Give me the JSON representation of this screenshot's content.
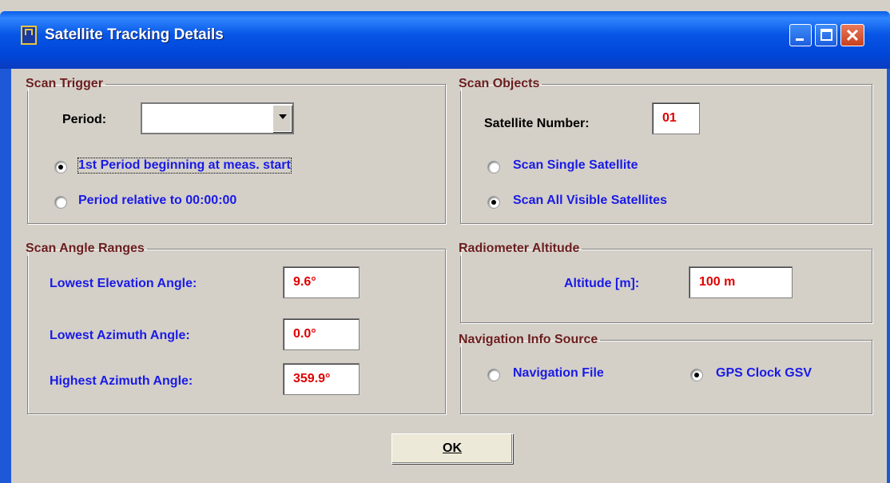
{
  "window": {
    "title": "Satellite Tracking Details"
  },
  "scan_trigger": {
    "legend": "Scan Trigger",
    "period_label": "Period:",
    "period_value": "",
    "radio1_label": "1st Period beginning at meas. start",
    "radio2_label": "Period relative to 00:00:00",
    "selected": "radio1"
  },
  "scan_objects": {
    "legend": "Scan Objects",
    "sat_number_label": "Satellite Number:",
    "sat_number_value": "01",
    "radio1_label": "Scan Single Satellite",
    "radio2_label": "Scan All Visible Satellites",
    "selected": "radio2"
  },
  "scan_angle": {
    "legend": "Scan Angle Ranges",
    "lowest_elevation_label": "Lowest Elevation Angle:",
    "lowest_elevation_value": "9.6°",
    "lowest_azimuth_label": "Lowest Azimuth Angle:",
    "lowest_azimuth_value": "0.0°",
    "highest_azimuth_label": "Highest Azimuth Angle:",
    "highest_azimuth_value": "359.9°"
  },
  "radiometer": {
    "legend": "Radiometer Altitude",
    "altitude_label": "Altitude [m]:",
    "altitude_value": "100 m"
  },
  "nav_source": {
    "legend": "Navigation Info Source",
    "radio1_label": "Navigation File",
    "radio2_label": "GPS Clock GSV",
    "selected": "radio2"
  },
  "ok_label": "OK",
  "colors": {
    "label_blue": "#1a1ae6",
    "legend_red": "#6b1d1d",
    "value_red": "#e00000",
    "title_blue": "#0046d8"
  }
}
